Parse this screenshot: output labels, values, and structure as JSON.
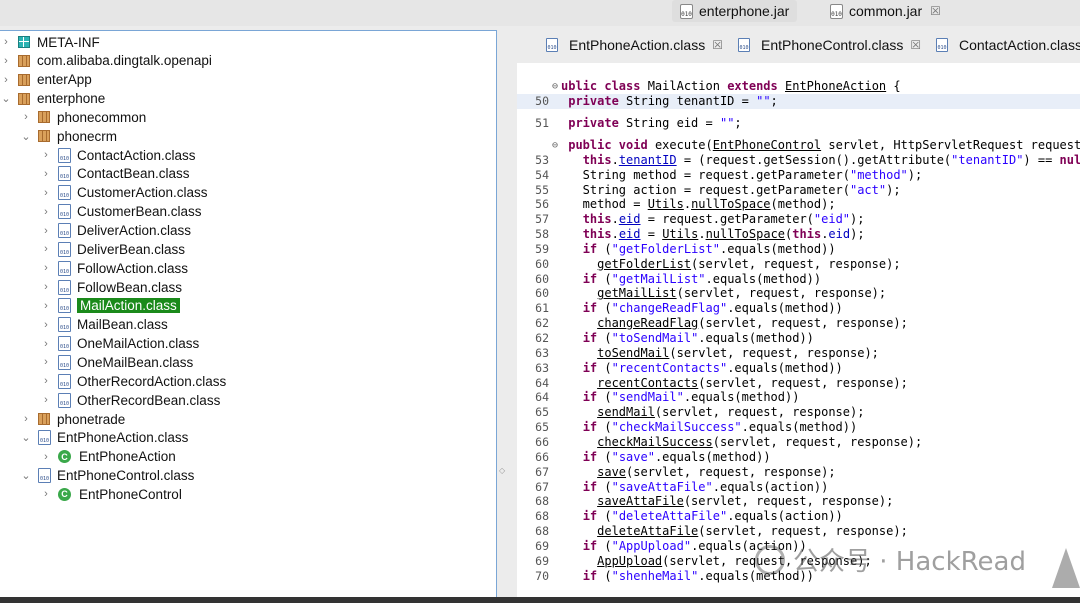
{
  "top_tabs": [
    {
      "label": "enterphone.jar",
      "icon": "jar-icon",
      "active": true
    },
    {
      "label": "common.jar",
      "icon": "jar-icon",
      "active": false
    }
  ],
  "tree": [
    {
      "label": "META-INF",
      "icon": "package-teal",
      "indent": 0,
      "chevron": "right"
    },
    {
      "label": "com.alibaba.dingtalk.openapi",
      "icon": "package",
      "indent": 0,
      "chevron": "right"
    },
    {
      "label": "enterApp",
      "icon": "package",
      "indent": 0,
      "chevron": "right"
    },
    {
      "label": "enterphone",
      "icon": "package",
      "indent": 0,
      "chevron": "down"
    },
    {
      "label": "phonecommon",
      "icon": "package",
      "indent": 1,
      "chevron": "right"
    },
    {
      "label": "phonecrm",
      "icon": "package",
      "indent": 1,
      "chevron": "down"
    },
    {
      "label": "ContactAction.class",
      "icon": "class-file",
      "indent": 2,
      "chevron": "right"
    },
    {
      "label": "ContactBean.class",
      "icon": "class-file",
      "indent": 2,
      "chevron": "right"
    },
    {
      "label": "CustomerAction.class",
      "icon": "class-file",
      "indent": 2,
      "chevron": "right"
    },
    {
      "label": "CustomerBean.class",
      "icon": "class-file",
      "indent": 2,
      "chevron": "right"
    },
    {
      "label": "DeliverAction.class",
      "icon": "class-file",
      "indent": 2,
      "chevron": "right"
    },
    {
      "label": "DeliverBean.class",
      "icon": "class-file",
      "indent": 2,
      "chevron": "right"
    },
    {
      "label": "FollowAction.class",
      "icon": "class-file",
      "indent": 2,
      "chevron": "right"
    },
    {
      "label": "FollowBean.class",
      "icon": "class-file",
      "indent": 2,
      "chevron": "right"
    },
    {
      "label": "MailAction.class",
      "icon": "class-file",
      "indent": 2,
      "chevron": "right",
      "selected": true
    },
    {
      "label": "MailBean.class",
      "icon": "class-file",
      "indent": 2,
      "chevron": "right"
    },
    {
      "label": "OneMailAction.class",
      "icon": "class-file",
      "indent": 2,
      "chevron": "right"
    },
    {
      "label": "OneMailBean.class",
      "icon": "class-file",
      "indent": 2,
      "chevron": "right"
    },
    {
      "label": "OtherRecordAction.class",
      "icon": "class-file",
      "indent": 2,
      "chevron": "right"
    },
    {
      "label": "OtherRecordBean.class",
      "icon": "class-file",
      "indent": 2,
      "chevron": "right"
    },
    {
      "label": "phonetrade",
      "icon": "package",
      "indent": 1,
      "chevron": "right"
    },
    {
      "label": "EntPhoneAction.class",
      "icon": "class-file",
      "indent": 1,
      "chevron": "down"
    },
    {
      "label": "EntPhoneAction",
      "icon": "class-abstract",
      "indent": 2,
      "chevron": "right"
    },
    {
      "label": "EntPhoneControl.class",
      "icon": "class-file",
      "indent": 1,
      "chevron": "down"
    },
    {
      "label": "EntPhoneControl",
      "icon": "class-public",
      "indent": 2,
      "chevron": "right"
    }
  ],
  "editor_tabs": [
    {
      "label": "EntPhoneAction.class",
      "icon": "class-file"
    },
    {
      "label": "EntPhoneControl.class",
      "icon": "class-file"
    },
    {
      "label": "ContactAction.class",
      "icon": "class-file"
    }
  ],
  "code_lines": [
    {
      "n": "",
      "fold": true,
      "segs": [
        {
          "t": "kw",
          "v": "ublic class"
        },
        {
          "t": "",
          "v": " MailAction "
        },
        {
          "t": "kw",
          "v": "extends"
        },
        {
          "t": "",
          "v": " "
        },
        {
          "t": "u",
          "v": "EntPhoneAction"
        },
        {
          "t": "",
          "v": " {"
        }
      ]
    },
    {
      "n": "50",
      "hl": true,
      "segs": [
        {
          "t": "",
          "v": " "
        },
        {
          "t": "kw",
          "v": "private"
        },
        {
          "t": "",
          "v": " String tenantID = "
        },
        {
          "t": "str",
          "v": "\"\""
        },
        {
          "t": "",
          "v": ";"
        }
      ]
    },
    {
      "n": "",
      "segs": []
    },
    {
      "n": "51",
      "segs": [
        {
          "t": "",
          "v": " "
        },
        {
          "t": "kw",
          "v": "private"
        },
        {
          "t": "",
          "v": " String eid = "
        },
        {
          "t": "str",
          "v": "\"\""
        },
        {
          "t": "",
          "v": ";"
        }
      ]
    },
    {
      "n": "",
      "segs": []
    },
    {
      "n": "",
      "fold": true,
      "segs": [
        {
          "t": "",
          "v": " "
        },
        {
          "t": "kw",
          "v": "public void"
        },
        {
          "t": "",
          "v": " execute("
        },
        {
          "t": "u",
          "v": "EntPhoneControl"
        },
        {
          "t": "",
          "v": " servlet, HttpServletRequest request, HttpServle"
        }
      ]
    },
    {
      "n": "53",
      "segs": [
        {
          "t": "",
          "v": "   "
        },
        {
          "t": "kw",
          "v": "this"
        },
        {
          "t": "",
          "v": "."
        },
        {
          "t": "fld u",
          "v": "tenantID"
        },
        {
          "t": "",
          "v": " = (request.getSession().getAttribute("
        },
        {
          "t": "str",
          "v": "\"tenantID\""
        },
        {
          "t": "",
          "v": ") == "
        },
        {
          "t": "kw",
          "v": "null"
        },
        {
          "t": "",
          "v": ")"
        }
      ]
    },
    {
      "n": "54",
      "segs": [
        {
          "t": "",
          "v": "   String method = request.getParameter("
        },
        {
          "t": "str",
          "v": "\"method\""
        },
        {
          "t": "",
          "v": ");"
        }
      ]
    },
    {
      "n": "55",
      "segs": [
        {
          "t": "",
          "v": "   String action = request.getParameter("
        },
        {
          "t": "str",
          "v": "\"act\""
        },
        {
          "t": "",
          "v": ");"
        }
      ]
    },
    {
      "n": "56",
      "segs": [
        {
          "t": "",
          "v": "   method = "
        },
        {
          "t": "u",
          "v": "Utils"
        },
        {
          "t": "",
          "v": "."
        },
        {
          "t": "u",
          "v": "nullToSpace"
        },
        {
          "t": "",
          "v": "(method);"
        }
      ]
    },
    {
      "n": "57",
      "segs": [
        {
          "t": "",
          "v": "   "
        },
        {
          "t": "kw",
          "v": "this"
        },
        {
          "t": "",
          "v": "."
        },
        {
          "t": "fld u",
          "v": "eid"
        },
        {
          "t": "",
          "v": " = request.getParameter("
        },
        {
          "t": "str",
          "v": "\"eid\""
        },
        {
          "t": "",
          "v": ");"
        }
      ]
    },
    {
      "n": "58",
      "segs": [
        {
          "t": "",
          "v": "   "
        },
        {
          "t": "kw",
          "v": "this"
        },
        {
          "t": "",
          "v": "."
        },
        {
          "t": "fld u",
          "v": "eid"
        },
        {
          "t": "",
          "v": " = "
        },
        {
          "t": "u",
          "v": "Utils"
        },
        {
          "t": "",
          "v": "."
        },
        {
          "t": "u",
          "v": "nullToSpace"
        },
        {
          "t": "",
          "v": "("
        },
        {
          "t": "kw",
          "v": "this"
        },
        {
          "t": "",
          "v": "."
        },
        {
          "t": "fld",
          "v": "eid"
        },
        {
          "t": "",
          "v": ");"
        }
      ]
    },
    {
      "n": "59",
      "segs": [
        {
          "t": "",
          "v": "   "
        },
        {
          "t": "kw",
          "v": "if"
        },
        {
          "t": "",
          "v": " ("
        },
        {
          "t": "str",
          "v": "\"getFolderList\""
        },
        {
          "t": "",
          "v": ".equals(method))"
        }
      ]
    },
    {
      "n": "60",
      "segs": [
        {
          "t": "",
          "v": "     "
        },
        {
          "t": "u",
          "v": "getFolderList"
        },
        {
          "t": "",
          "v": "(servlet, request, response);"
        }
      ]
    },
    {
      "n": "60",
      "segs": [
        {
          "t": "",
          "v": "   "
        },
        {
          "t": "kw",
          "v": "if"
        },
        {
          "t": "",
          "v": " ("
        },
        {
          "t": "str",
          "v": "\"getMailList\""
        },
        {
          "t": "",
          "v": ".equals(method))"
        }
      ]
    },
    {
      "n": "60",
      "segs": [
        {
          "t": "",
          "v": "     "
        },
        {
          "t": "u",
          "v": "getMailList"
        },
        {
          "t": "",
          "v": "(servlet, request, response);"
        }
      ]
    },
    {
      "n": "61",
      "segs": [
        {
          "t": "",
          "v": "   "
        },
        {
          "t": "kw",
          "v": "if"
        },
        {
          "t": "",
          "v": " ("
        },
        {
          "t": "str",
          "v": "\"changeReadFlag\""
        },
        {
          "t": "",
          "v": ".equals(method))"
        }
      ]
    },
    {
      "n": "62",
      "segs": [
        {
          "t": "",
          "v": "     "
        },
        {
          "t": "u",
          "v": "changeReadFlag"
        },
        {
          "t": "",
          "v": "(servlet, request, response);"
        }
      ]
    },
    {
      "n": "62",
      "segs": [
        {
          "t": "",
          "v": "   "
        },
        {
          "t": "kw",
          "v": "if"
        },
        {
          "t": "",
          "v": " ("
        },
        {
          "t": "str",
          "v": "\"toSendMail\""
        },
        {
          "t": "",
          "v": ".equals(method))"
        }
      ]
    },
    {
      "n": "63",
      "segs": [
        {
          "t": "",
          "v": "     "
        },
        {
          "t": "u",
          "v": "toSendMail"
        },
        {
          "t": "",
          "v": "(servlet, request, response);"
        }
      ]
    },
    {
      "n": "63",
      "segs": [
        {
          "t": "",
          "v": "   "
        },
        {
          "t": "kw",
          "v": "if"
        },
        {
          "t": "",
          "v": " ("
        },
        {
          "t": "str",
          "v": "\"recentContacts\""
        },
        {
          "t": "",
          "v": ".equals(method))"
        }
      ]
    },
    {
      "n": "64",
      "segs": [
        {
          "t": "",
          "v": "     "
        },
        {
          "t": "u",
          "v": "recentContacts"
        },
        {
          "t": "",
          "v": "(servlet, request, response);"
        }
      ]
    },
    {
      "n": "64",
      "segs": [
        {
          "t": "",
          "v": "   "
        },
        {
          "t": "kw",
          "v": "if"
        },
        {
          "t": "",
          "v": " ("
        },
        {
          "t": "str",
          "v": "\"sendMail\""
        },
        {
          "t": "",
          "v": ".equals(method))"
        }
      ]
    },
    {
      "n": "65",
      "segs": [
        {
          "t": "",
          "v": "     "
        },
        {
          "t": "u",
          "v": "sendMail"
        },
        {
          "t": "",
          "v": "(servlet, request, response);"
        }
      ]
    },
    {
      "n": "65",
      "segs": [
        {
          "t": "",
          "v": "   "
        },
        {
          "t": "kw",
          "v": "if"
        },
        {
          "t": "",
          "v": " ("
        },
        {
          "t": "str",
          "v": "\"checkMailSuccess\""
        },
        {
          "t": "",
          "v": ".equals(method))"
        }
      ]
    },
    {
      "n": "66",
      "segs": [
        {
          "t": "",
          "v": "     "
        },
        {
          "t": "u",
          "v": "checkMailSuccess"
        },
        {
          "t": "",
          "v": "(servlet, request, response);"
        }
      ]
    },
    {
      "n": "66",
      "segs": [
        {
          "t": "",
          "v": "   "
        },
        {
          "t": "kw",
          "v": "if"
        },
        {
          "t": "",
          "v": " ("
        },
        {
          "t": "str",
          "v": "\"save\""
        },
        {
          "t": "",
          "v": ".equals(method))"
        }
      ]
    },
    {
      "n": "67",
      "segs": [
        {
          "t": "",
          "v": "     "
        },
        {
          "t": "u",
          "v": "save"
        },
        {
          "t": "",
          "v": "(servlet, request, response);"
        }
      ]
    },
    {
      "n": "67",
      "segs": [
        {
          "t": "",
          "v": "   "
        },
        {
          "t": "kw",
          "v": "if"
        },
        {
          "t": "",
          "v": " ("
        },
        {
          "t": "str",
          "v": "\"saveAttaFile\""
        },
        {
          "t": "",
          "v": ".equals(action))"
        }
      ]
    },
    {
      "n": "68",
      "segs": [
        {
          "t": "",
          "v": "     "
        },
        {
          "t": "u",
          "v": "saveAttaFile"
        },
        {
          "t": "",
          "v": "(servlet, request, response);"
        }
      ]
    },
    {
      "n": "68",
      "segs": [
        {
          "t": "",
          "v": "   "
        },
        {
          "t": "kw",
          "v": "if"
        },
        {
          "t": "",
          "v": " ("
        },
        {
          "t": "str",
          "v": "\"deleteAttaFile\""
        },
        {
          "t": "",
          "v": ".equals(action))"
        }
      ]
    },
    {
      "n": "68",
      "segs": [
        {
          "t": "",
          "v": "     "
        },
        {
          "t": "u",
          "v": "deleteAttaFile"
        },
        {
          "t": "",
          "v": "(servlet, request, response);"
        }
      ]
    },
    {
      "n": "69",
      "segs": [
        {
          "t": "",
          "v": "   "
        },
        {
          "t": "kw",
          "v": "if"
        },
        {
          "t": "",
          "v": " ("
        },
        {
          "t": "str",
          "v": "\"AppUpload\""
        },
        {
          "t": "",
          "v": ".equals(action))"
        }
      ]
    },
    {
      "n": "69",
      "segs": [
        {
          "t": "",
          "v": "     "
        },
        {
          "t": "u",
          "v": "AppUpload"
        },
        {
          "t": "",
          "v": "(servlet, request, response);"
        }
      ]
    },
    {
      "n": "70",
      "segs": [
        {
          "t": "",
          "v": "   "
        },
        {
          "t": "kw",
          "v": "if"
        },
        {
          "t": "",
          "v": " ("
        },
        {
          "t": "str",
          "v": "\"shenheMail\""
        },
        {
          "t": "",
          "v": ".equals(method))"
        }
      ]
    }
  ],
  "watermark": {
    "text": "公众号 · HackRead"
  },
  "colors": {
    "keyword": "#7f0055",
    "string": "#2a00ff",
    "field": "#0000c0",
    "selection": "#1b8a1b"
  }
}
